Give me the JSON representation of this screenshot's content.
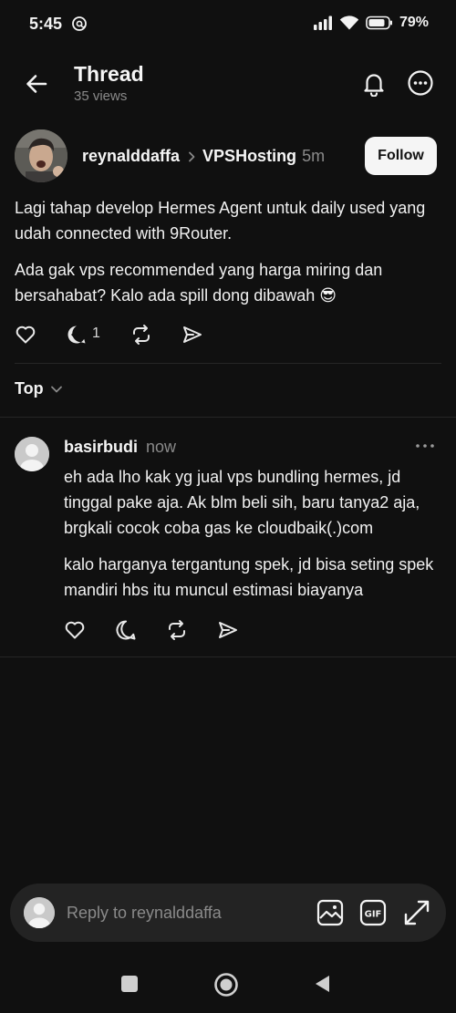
{
  "status_bar": {
    "time": "5:45",
    "battery": "79%"
  },
  "header": {
    "title": "Thread",
    "views": "35 views"
  },
  "post": {
    "author": "reynalddaffa",
    "community": "VPSHosting",
    "time": "5m",
    "follow_label": "Follow",
    "paragraphs": [
      "Lagi tahap develop Hermes Agent untuk daily used yang udah connected with 9Router.",
      "Ada gak vps recommended yang harga miring dan bersahabat? Kalo ada spill dong dibawah 😎"
    ],
    "reply_count": "1"
  },
  "sort": {
    "label": "Top"
  },
  "reply": {
    "author": "basirbudi",
    "time": "now",
    "paragraphs": [
      "eh ada lho kak yg jual vps bundling hermes, jd tinggal pake aja. Ak blm beli sih, baru tanya2 aja, brgkali cocok coba gas ke cloudbaik(.)com",
      "kalo harganya tergantung spek, jd bisa seting spek mandiri hbs itu muncul estimasi biayanya"
    ]
  },
  "composer": {
    "placeholder": "Reply to reynalddaffa"
  },
  "icons": {
    "status": [
      "threads-icon",
      "signal-icon",
      "wifi-icon",
      "battery-icon"
    ],
    "header": [
      "back-arrow-icon",
      "bell-icon",
      "more-icon"
    ],
    "actions": [
      "heart-icon",
      "comment-icon",
      "repost-icon",
      "share-icon"
    ],
    "composer": [
      "image-icon",
      "gif-icon",
      "expand-icon"
    ],
    "nav": [
      "square-icon",
      "home-circle-icon",
      "triangle-back-icon"
    ]
  },
  "colors": {
    "background": "#101010",
    "text": "#f3f3f3",
    "muted": "#8a8a8a",
    "composer_bg": "#232323",
    "follow_bg": "#f5f5f5"
  }
}
